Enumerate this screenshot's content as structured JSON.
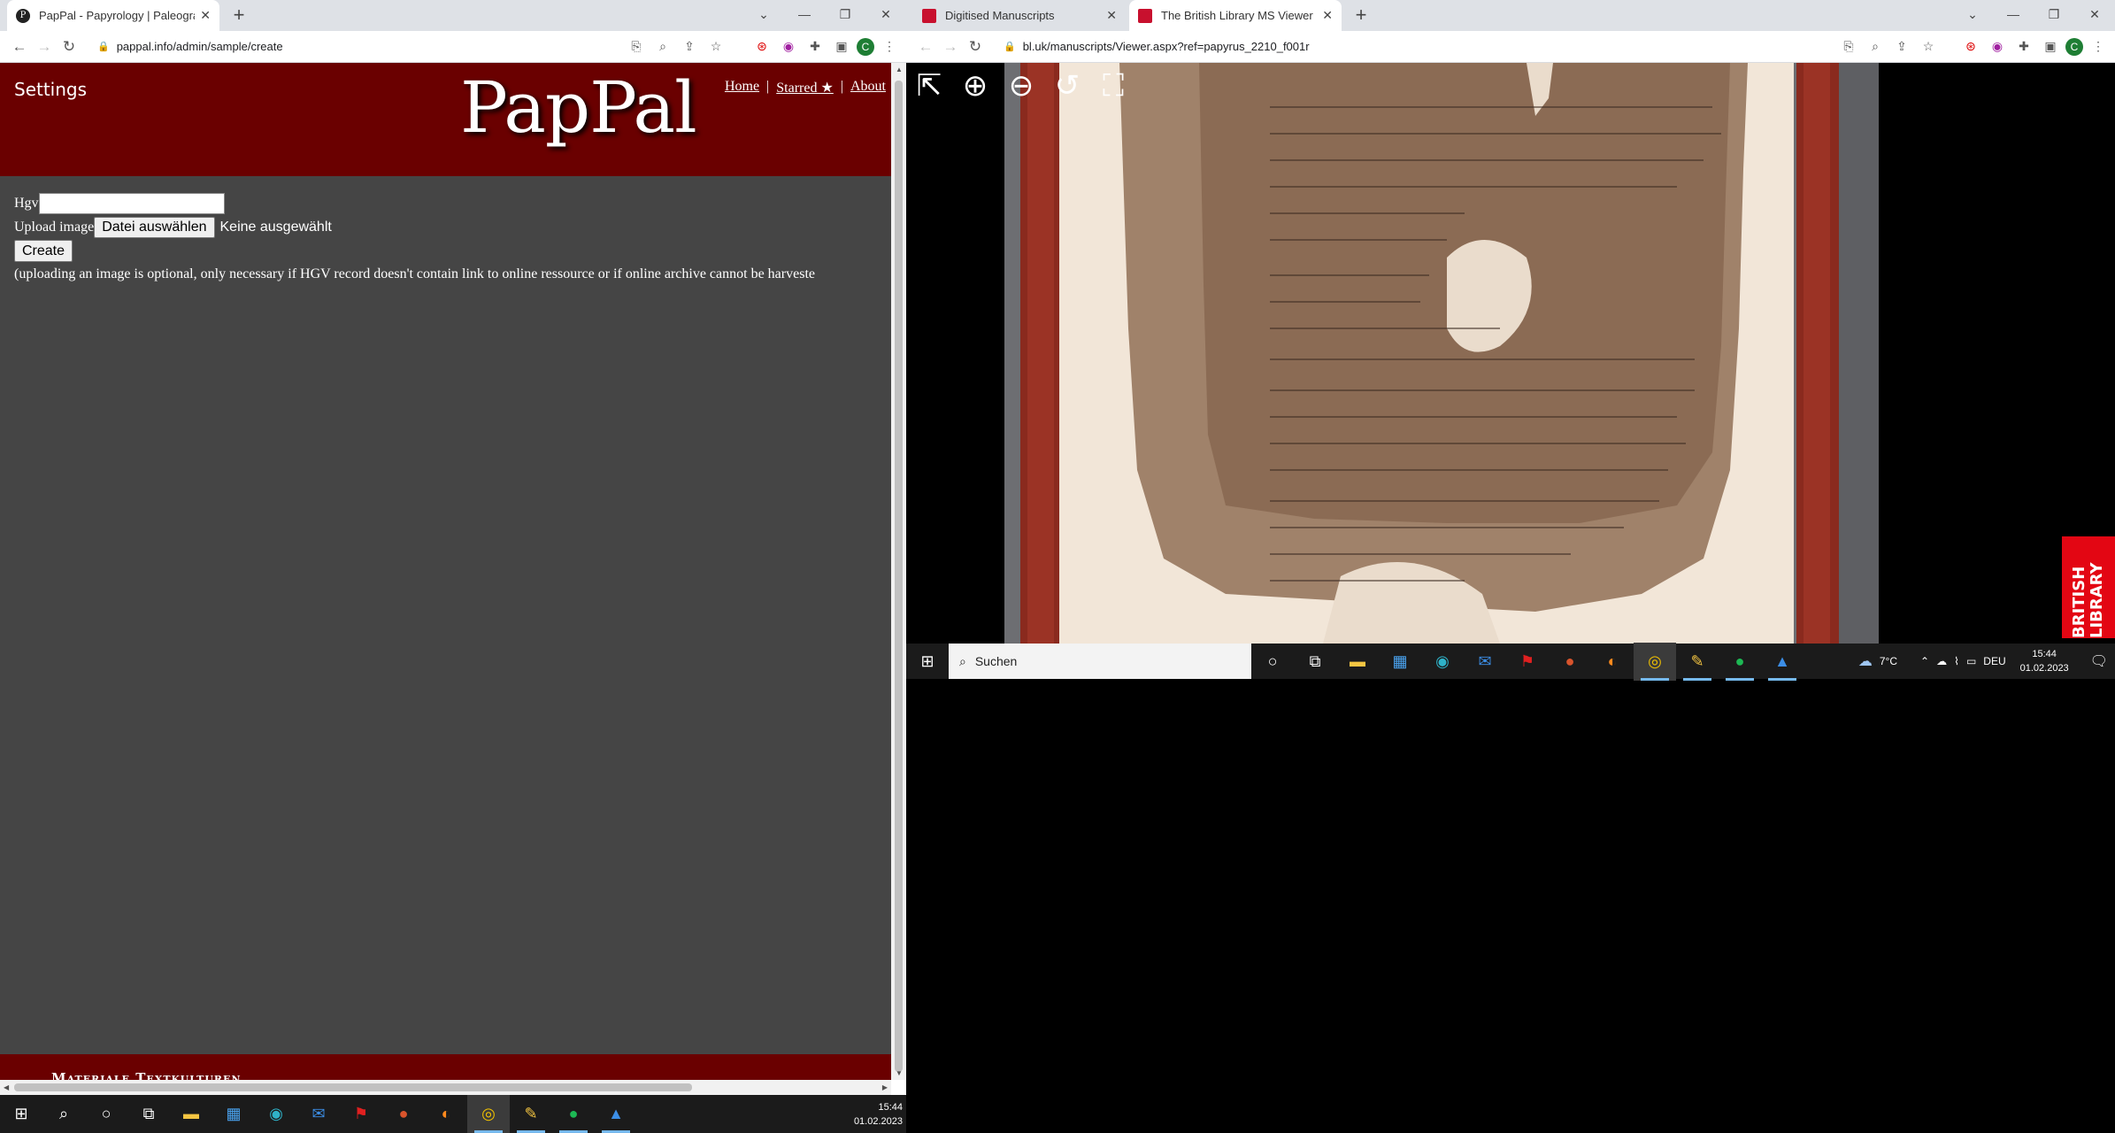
{
  "left_browser": {
    "tabs": [
      {
        "title": "PapPal - Papyrology | Paleograph",
        "favicon": "P"
      }
    ],
    "url": "pappal.info/admin/sample/create",
    "avatar_letter": "C"
  },
  "site": {
    "settings_label": "Settings",
    "logo": "PapPal",
    "nav": [
      {
        "label": "Home"
      },
      {
        "label": "Starred ★"
      },
      {
        "label": "About"
      }
    ],
    "nav_separator": "|",
    "form": {
      "hgv_label": "Hgv",
      "upload_label": "Upload image",
      "file_button": "Datei auswählen",
      "file_status": "Keine ausgewählt",
      "create_button": "Create",
      "note": "(uploading an image is optional, only necessary if HGV record doesn't contain link to online ressource or if online archive cannot be harveste"
    },
    "footer_text": "Materiale Textkulturen"
  },
  "right_browser": {
    "tabs": [
      {
        "title": "Digitised Manuscripts",
        "active": false
      },
      {
        "title": "The British Library MS Viewer",
        "active": true
      }
    ],
    "url": "bl.uk/manuscripts/Viewer.aspx?ref=papyrus_2210_f001r",
    "avatar_letter": "C",
    "viewer_logo": "BRITISH LIBRARY"
  },
  "taskbar_left": {
    "time": "15:44",
    "date": "01.02.2023"
  },
  "taskbar_right": {
    "search_placeholder": "Suchen",
    "weather": "7°C",
    "language": "DEU",
    "time": "15:44",
    "date": "01.02.2023"
  },
  "colors": {
    "header_bg": "#6a0000",
    "page_bg": "#454545",
    "bl_red": "#e30613"
  }
}
